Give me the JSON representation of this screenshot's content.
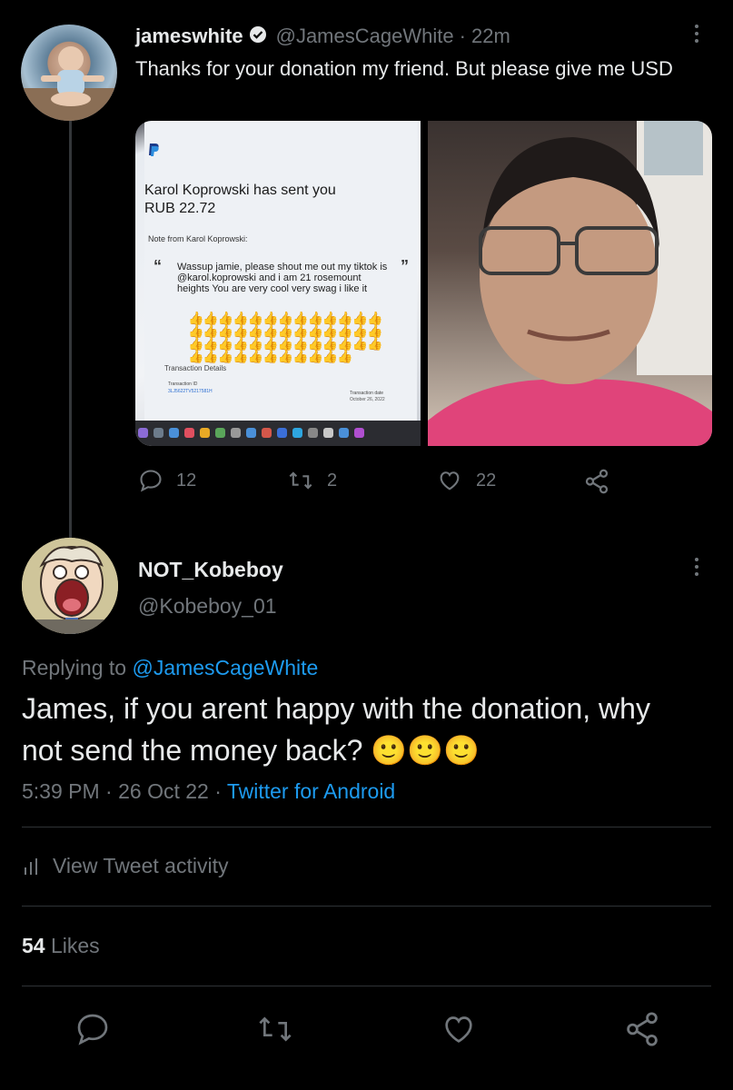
{
  "tweet1": {
    "display_name": "jameswhite",
    "handle": "@JamesCageWhite",
    "time": "· 22m",
    "text": "Thanks for your donation my friend. But please give me USD",
    "media_left": {
      "heading": "Karol Koprowski has sent you",
      "amount": "RUB 22.72",
      "note_label": "Note from Karol Koprowski:",
      "note_open_quote": "“",
      "note_close_quote": "”",
      "note": "Wassup jamie, please shout me out my tiktok is @karol.koprowski and i am 21 rosemount heights You are very cool very swag i like it",
      "thumbs_emoji": "👍👍👍👍👍👍👍👍👍👍👍👍👍👍👍👍👍👍👍👍👍👍👍👍👍👍👍👍👍👍👍👍👍👍👍👍👍👍👍👍👍👍👍👍👍👍👍👍👍👍",
      "details_label": "Transaction Details",
      "transaction_id_label": "Transaction ID",
      "transaction_id": "3LJ5622TV5217581H",
      "transaction_date_label": "Transaction date",
      "transaction_date": "October 26, 2022"
    },
    "replies": "12",
    "retweets": "2",
    "likes": "22"
  },
  "tweet2": {
    "display_name": "NOT_Kobeboy",
    "handle": "@Kobeboy_01",
    "replying_prefix": "Replying to",
    "replying_to": "@JamesCageWhite",
    "text": "James, if you arent happy with the donation, why not send the money back?",
    "emojis": "🙂🙂🙂",
    "time": "5:39 PM · 26 Oct 22 ·",
    "source": "Twitter for Android",
    "activity_label": "View Tweet activity",
    "likes_count": "54",
    "likes_label": "Likes"
  },
  "colors": {
    "background": "#000000",
    "text": "#e7e9ea",
    "muted": "#71767b",
    "accent": "#1d9bf0",
    "divider": "#2f3336"
  },
  "icons": [
    "verified-badge-icon",
    "more-icon",
    "reply-icon",
    "retweet-icon",
    "like-icon",
    "share-icon",
    "activity-icon"
  ]
}
